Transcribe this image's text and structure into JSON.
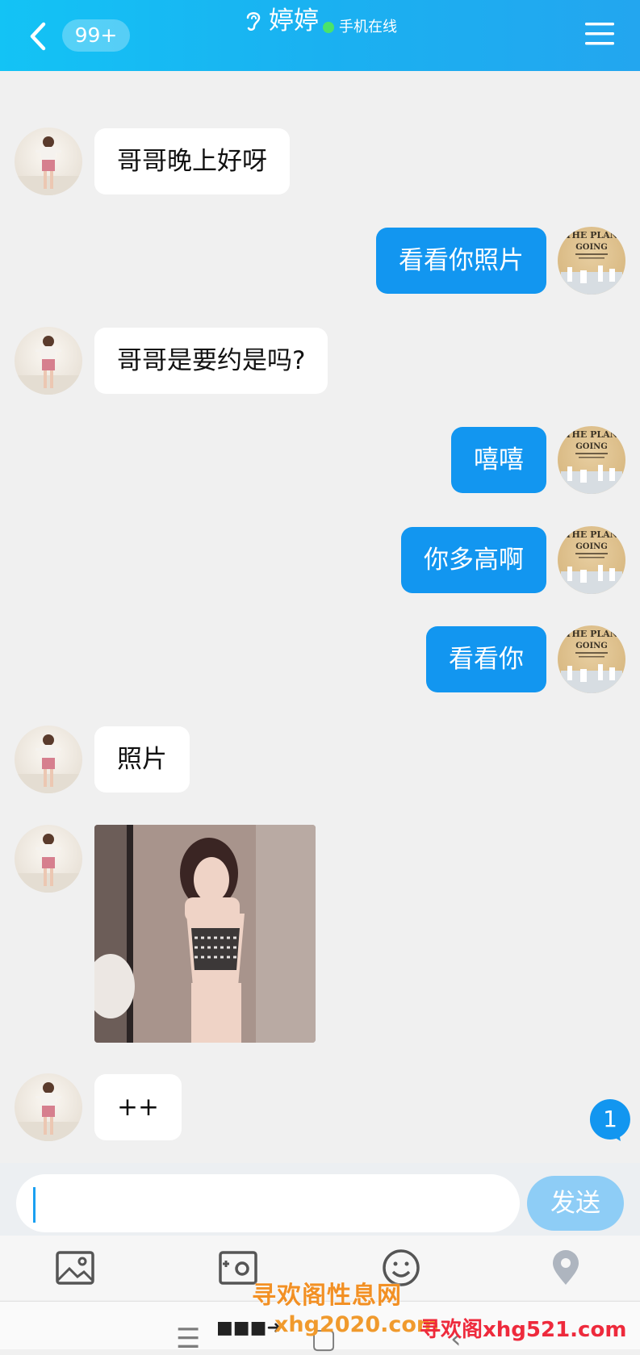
{
  "header": {
    "back_icon": "chevron-left-icon",
    "unread_badge": "99+",
    "title_icon": "ear-icon",
    "title": "婷婷",
    "status": "手机在线",
    "status_color": "#4ae36a",
    "menu_icon": "menu-icon",
    "gradient": [
      "#13c3f5",
      "#23a6ef"
    ]
  },
  "messages": [
    {
      "side": "left",
      "type": "text",
      "text": "哥哥晚上好呀"
    },
    {
      "side": "right",
      "type": "text",
      "text": "看看你照片"
    },
    {
      "side": "left",
      "type": "text",
      "text": "哥哥是要约是吗?"
    },
    {
      "side": "right",
      "type": "text",
      "text": "嘻嘻"
    },
    {
      "side": "right",
      "type": "text",
      "text": "你多高啊"
    },
    {
      "side": "right",
      "type": "text",
      "text": "看看你"
    },
    {
      "side": "left",
      "type": "text",
      "text": "照片"
    },
    {
      "side": "left",
      "type": "image"
    },
    {
      "side": "left",
      "type": "text",
      "text": "++"
    }
  ],
  "avatar_right_text": {
    "line1": "THE PLAN",
    "line2": "GOING"
  },
  "unread_bubble": "1",
  "composer": {
    "send_label": "发送",
    "send_color": "#8ecdf6"
  },
  "toolbar": {
    "icons": [
      "image-icon",
      "camera-icon",
      "emoji-icon",
      "location-icon"
    ]
  },
  "nav": {
    "icons": [
      "menu-nav-icon",
      "home-nav-icon",
      "back-nav-icon"
    ]
  },
  "watermarks": {
    "line1": "寻欢阁性息网",
    "line2": "xhg2020.com",
    "line3": "寻欢阁xhg521.com"
  },
  "colors": {
    "accent": "#1296f0",
    "background": "#f0f0f0"
  }
}
